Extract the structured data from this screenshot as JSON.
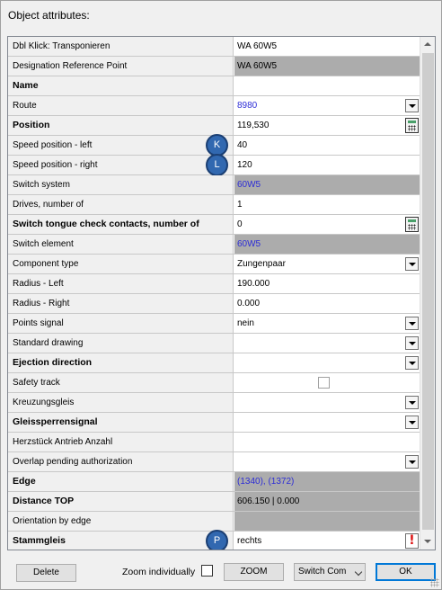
{
  "window": {
    "title": "Object attributes:"
  },
  "rows": [
    {
      "label": "Dbl Klick: Transponieren",
      "bold": false,
      "value": "WA 60W5",
      "style": "",
      "control": ""
    },
    {
      "label": "Designation Reference Point",
      "bold": false,
      "value": "WA 60W5",
      "style": "grey",
      "control": ""
    },
    {
      "label": "Name",
      "bold": true,
      "value": "",
      "style": "",
      "control": ""
    },
    {
      "label": "Route",
      "bold": false,
      "value": "8980",
      "style": "blue",
      "control": "dropdown"
    },
    {
      "label": "Position",
      "bold": true,
      "value": "119,530",
      "style": "",
      "control": "calculator"
    },
    {
      "label": "Speed position - left",
      "bold": false,
      "value": "40",
      "style": "",
      "control": "",
      "badge": "K"
    },
    {
      "label": "Speed position - right",
      "bold": false,
      "value": "120",
      "style": "",
      "control": "",
      "badge": "L"
    },
    {
      "label": "Switch system",
      "bold": false,
      "value": "60W5",
      "style": "grey blue",
      "control": ""
    },
    {
      "label": "Drives, number of",
      "bold": false,
      "value": "1",
      "style": "",
      "control": ""
    },
    {
      "label": "Switch tongue check contacts, number of",
      "bold": true,
      "value": "0",
      "style": "",
      "control": "calculator"
    },
    {
      "label": "Switch element",
      "bold": false,
      "value": "60W5",
      "style": "grey blue",
      "control": ""
    },
    {
      "label": "Component type",
      "bold": false,
      "value": "Zungenpaar",
      "style": "",
      "control": "dropdown"
    },
    {
      "label": "Radius - Left",
      "bold": false,
      "value": "190.000",
      "style": "",
      "control": ""
    },
    {
      "label": "Radius - Right",
      "bold": false,
      "value": "0.000",
      "style": "",
      "control": ""
    },
    {
      "label": "Points signal",
      "bold": false,
      "value": "nein",
      "style": "",
      "control": "dropdown"
    },
    {
      "label": "Standard drawing",
      "bold": false,
      "value": "",
      "style": "",
      "control": "dropdown"
    },
    {
      "label": "Ejection direction",
      "bold": true,
      "value": "",
      "style": "",
      "control": "dropdown"
    },
    {
      "label": "Safety track",
      "bold": false,
      "value": "",
      "style": "",
      "control": "checkbox"
    },
    {
      "label": "Kreuzungsgleis",
      "bold": false,
      "value": "",
      "style": "",
      "control": "dropdown"
    },
    {
      "label": "Gleissperrensignal",
      "bold": true,
      "value": "",
      "style": "",
      "control": "dropdown"
    },
    {
      "label": "Herzstück Antrieb Anzahl",
      "bold": false,
      "value": "",
      "style": "",
      "control": ""
    },
    {
      "label": "Overlap pending authorization",
      "bold": false,
      "value": "",
      "style": "",
      "control": "dropdown"
    },
    {
      "label": "Edge",
      "bold": true,
      "value": "(1340), (1372)",
      "style": "grey blue",
      "control": ""
    },
    {
      "label": "Distance TOP",
      "bold": true,
      "value": "606.150 | 0.000",
      "style": "grey",
      "control": ""
    },
    {
      "label": "Orientation by edge",
      "bold": false,
      "value": "",
      "style": "grey",
      "control": ""
    },
    {
      "label": "Stammgleis",
      "bold": true,
      "value": "rechts",
      "style": "",
      "control": "alert",
      "badge": "P"
    }
  ],
  "footer": {
    "delete_label": "Delete",
    "zoom_individually_label": "Zoom individually",
    "zoom_label": "ZOOM",
    "switch_select_value": "Switch Com",
    "ok_label": "OK"
  },
  "icons": {
    "calculator": "calculator-icon",
    "dropdown": "chevron-down-icon",
    "alert": "exclamation-icon"
  },
  "colors": {
    "link_blue": "#2d2dd6",
    "readonly_grey": "#acacac",
    "badge_blue": "#3168b0",
    "alert_red": "#dd1111"
  }
}
